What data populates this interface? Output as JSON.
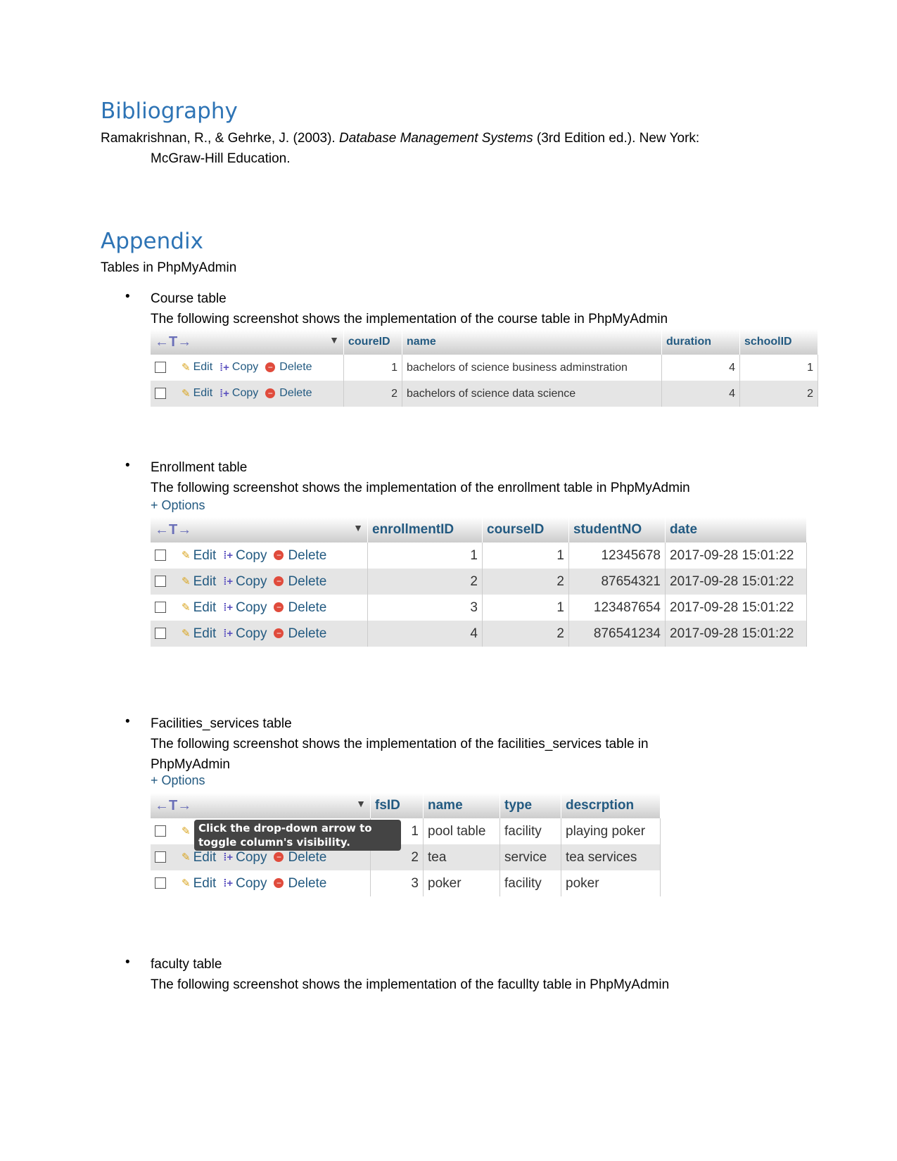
{
  "bibliography": {
    "heading": "Bibliography",
    "entry_before": "Ramakrishnan, R., & Gehrke, J. (2003). ",
    "entry_title": "Database Management Systems",
    "entry_after": " (3rd Edition ed.). New York:",
    "entry_line2": "McGraw-Hill Education."
  },
  "appendix": {
    "heading": "Appendix",
    "subtitle": "Tables in PhpMyAdmin"
  },
  "actions": {
    "edit": "Edit",
    "copy": "Copy",
    "delete": "Delete",
    "options": "+ Options",
    "arrows": "←T→",
    "sort": "▼"
  },
  "sections": [
    {
      "title": "Course table",
      "desc": "The following screenshot shows the implementation of the course table in PhpMyAdmin",
      "desc2": "",
      "columns": [
        "coureID",
        "name",
        "duration",
        "schoolID"
      ],
      "numeric": [
        true,
        false,
        true,
        true
      ],
      "rows": [
        [
          "1",
          "bachelors of science business adminstration",
          "4",
          "1"
        ],
        [
          "2",
          "bachelors of science data science",
          "4",
          "2"
        ]
      ]
    },
    {
      "title": "Enrollment table",
      "desc": "The following screenshot shows the implementation of the enrollment table in PhpMyAdmin",
      "desc2": "",
      "columns": [
        "enrollmentID",
        "courseID",
        "studentNO",
        "date"
      ],
      "numeric": [
        true,
        true,
        true,
        false
      ],
      "rows": [
        [
          "1",
          "1",
          "12345678",
          "2017-09-28 15:01:22"
        ],
        [
          "2",
          "2",
          "87654321",
          "2017-09-28 15:01:22"
        ],
        [
          "3",
          "1",
          "123487654",
          "2017-09-28 15:01:22"
        ],
        [
          "4",
          "2",
          "876541234",
          "2017-09-28 15:01:22"
        ]
      ]
    },
    {
      "title": "Facilities_services table",
      "desc": "The following screenshot shows the implementation of the facilities_services table in",
      "desc2": "PhpMyAdmin",
      "columns": [
        "fsID",
        "name",
        "type",
        "descrption"
      ],
      "numeric": [
        true,
        false,
        false,
        false
      ],
      "rows": [
        [
          "1",
          "pool table",
          "facility",
          "playing poker"
        ],
        [
          "2",
          "tea",
          "service",
          "tea services"
        ],
        [
          "3",
          "poker",
          "facility",
          "poker"
        ]
      ],
      "tooltip": "Click the drop-down arrow to toggle column's visibility."
    },
    {
      "title": "faculty table",
      "desc": "The following screenshot shows the implementation of the facullty table in PhpMyAdmin",
      "desc2": ""
    }
  ]
}
